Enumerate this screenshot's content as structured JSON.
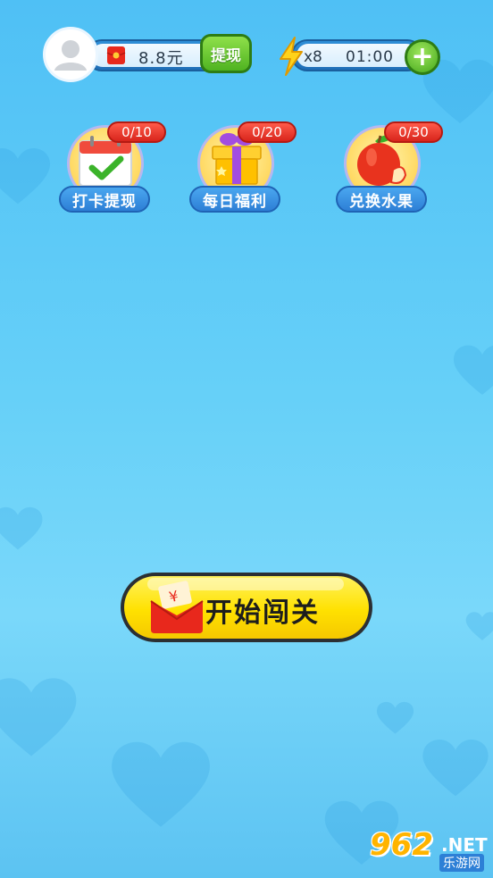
{
  "header": {
    "balance": "8.8元",
    "withdraw_label": "提现",
    "energy_count": "x8",
    "energy_timer": "01:00",
    "add_label": "+"
  },
  "features": [
    {
      "label": "打卡提现",
      "progress": "0/10",
      "icon": "calendar-check-icon"
    },
    {
      "label": "每日福利",
      "progress": "0/20",
      "icon": "gift-box-icon"
    },
    {
      "label": "兑换水果",
      "progress": "0/30",
      "icon": "apple-icon"
    }
  ],
  "start_button": {
    "label": "开始闯关",
    "icon": "red-envelope-icon"
  },
  "watermark": {
    "number": "962",
    "net": ".NET",
    "site": "乐游网"
  },
  "colors": {
    "background": "#5cc8f6",
    "accent_green": "#4fb321",
    "badge_red": "#d8251c",
    "start_yellow": "#ffe100"
  }
}
